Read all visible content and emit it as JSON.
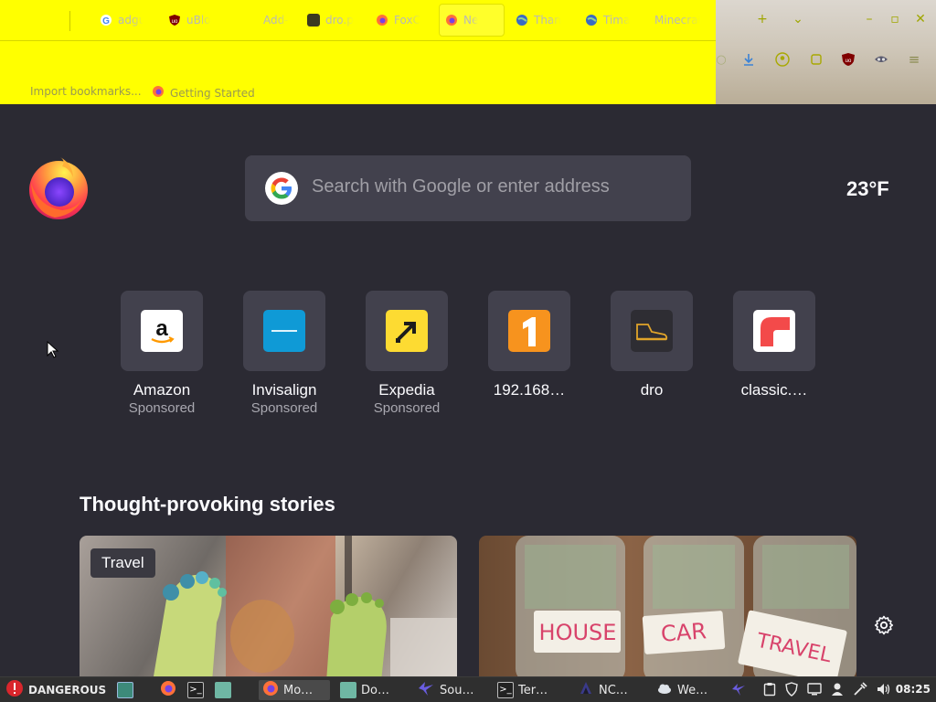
{
  "tabs": [
    {
      "label": "adgu",
      "icon": "google-favicon",
      "color": "#4285f4"
    },
    {
      "label": "uBlo",
      "icon": "ublock-favicon",
      "color": "#800000"
    },
    {
      "label": "Add-",
      "icon": "none",
      "color": ""
    },
    {
      "label": "dro.p",
      "icon": "dro-favicon",
      "color": "#3b3a20"
    },
    {
      "label": "FoxC",
      "icon": "firefox-favicon",
      "color": "#ff7139"
    },
    {
      "label": "Ne",
      "icon": "firefox-favicon",
      "color": "#ff7139",
      "active": true
    },
    {
      "label": "Than",
      "icon": "globe-favicon",
      "color": "#3a6bc4"
    },
    {
      "label": "Tima",
      "icon": "globe-favicon",
      "color": "#3a6bc4"
    },
    {
      "label": "Minecrai",
      "icon": "none",
      "color": ""
    }
  ],
  "bookmarks": {
    "import": "Import bookmarks...",
    "getting_started": "Getting Started"
  },
  "search": {
    "placeholder": "Search with Google or enter address"
  },
  "weather": {
    "temperature": "23°F"
  },
  "top_sites": [
    {
      "title": "Amazon",
      "subtitle": "Sponsored",
      "icon": "amazon-icon"
    },
    {
      "title": "Invisalign",
      "subtitle": "Sponsored",
      "icon": "invisalign-icon"
    },
    {
      "title": "Expedia",
      "subtitle": "Sponsored",
      "icon": "expedia-icon"
    },
    {
      "title": "192.168…",
      "subtitle": "",
      "icon": "number-one-icon"
    },
    {
      "title": "dro",
      "subtitle": "",
      "icon": "shoe-icon"
    },
    {
      "title": "classic.…",
      "subtitle": "",
      "icon": "classic-icon"
    }
  ],
  "stories": {
    "heading": "Thought-provoking stories",
    "cards": [
      {
        "badge": "Travel",
        "image": "toe-socks-photo"
      },
      {
        "badge": "",
        "image": "savings-jars-photo",
        "jar_labels": [
          "HOUSE",
          "CAR",
          "TRAVEL"
        ]
      }
    ]
  },
  "taskbar": {
    "warning": "DANGEROUS",
    "items": [
      {
        "label": "Mo…",
        "icon": "firefox-icon",
        "active": true
      },
      {
        "label": "Do…",
        "icon": "folder-icon"
      },
      {
        "label": "Sou…",
        "icon": "audio-icon"
      },
      {
        "label": "Ter…",
        "icon": "terminal-icon"
      },
      {
        "label": "NC…",
        "icon": "app-icon"
      },
      {
        "label": "We…",
        "icon": "weather-icon"
      }
    ],
    "clock": "08:25"
  },
  "colors": {
    "chrome_bg": "#ffff00",
    "content_bg": "#2b2a33",
    "tile_bg": "#42414d",
    "taskbar_bg": "#2f2f2f"
  }
}
